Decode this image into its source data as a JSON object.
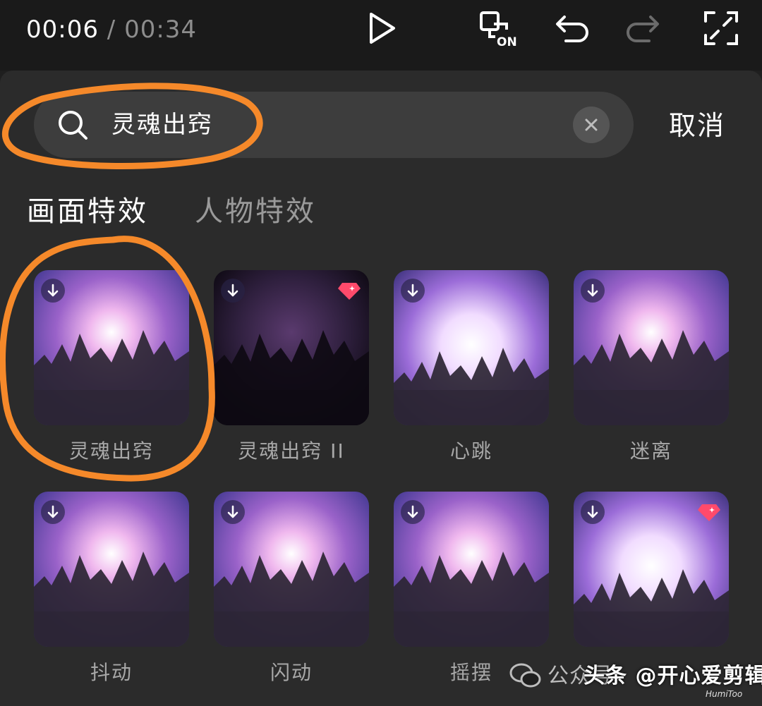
{
  "topbar": {
    "current_time": "00:06",
    "separator": "/",
    "total_time": "00:34",
    "on_badge": "ON",
    "icons": [
      "play-icon",
      "canvas-on-icon",
      "undo-icon",
      "redo-icon",
      "fullscreen-icon"
    ]
  },
  "search": {
    "query": "灵魂出窍",
    "cancel_label": "取消"
  },
  "tabs": [
    {
      "label": "画面特效",
      "active": true
    },
    {
      "label": "人物特效",
      "active": false
    }
  ],
  "effects": [
    {
      "label": "灵魂出窍",
      "premium": false
    },
    {
      "label": "灵魂出窍 II",
      "premium": true
    },
    {
      "label": "心跳",
      "premium": false
    },
    {
      "label": "迷离",
      "premium": false
    },
    {
      "label": "抖动",
      "premium": false
    },
    {
      "label": "闪动",
      "premium": false
    },
    {
      "label": "摇摆",
      "premium": false
    },
    {
      "label": "",
      "premium": true
    }
  ],
  "watermark": {
    "text_1": "公众号",
    "text_2": "头条 @开心爱剪辑",
    "small": "HumiToo"
  },
  "colors": {
    "annotation": "#f5892a",
    "premium_gem": "#ff4a6b",
    "panel_bg": "#2b2b2b"
  }
}
